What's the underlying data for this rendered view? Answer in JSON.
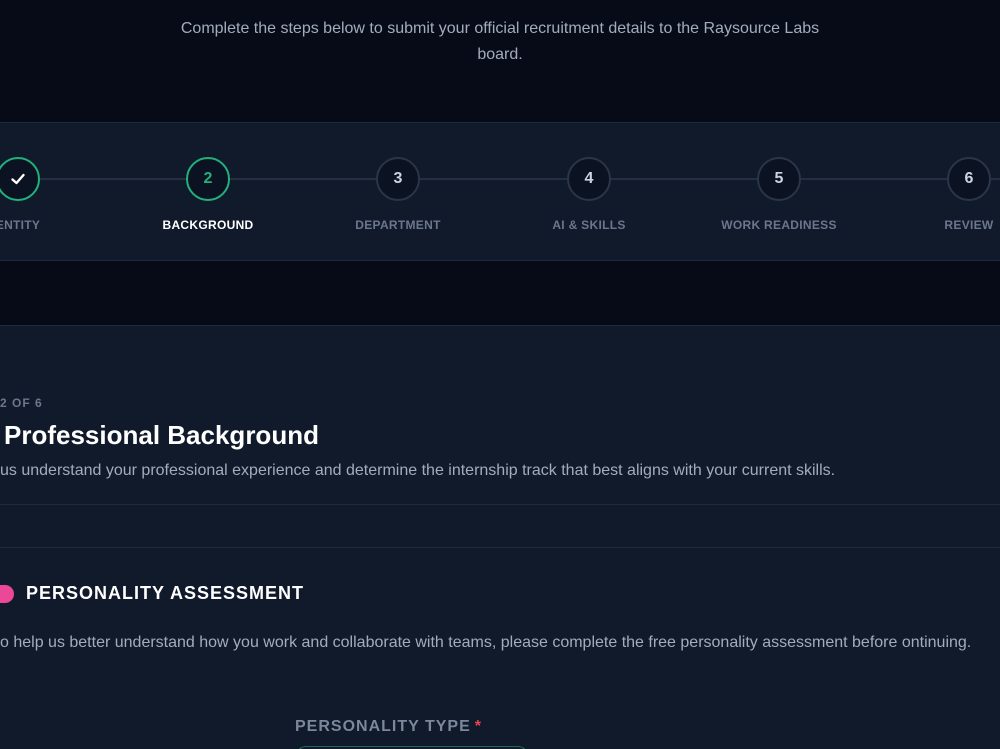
{
  "intro": {
    "line1": "Complete the steps below to submit your official recruitment details to the Raysource Labs",
    "line2": "board."
  },
  "stepper": {
    "steps": [
      {
        "number": "",
        "label": "ENTITY",
        "status": "done",
        "icon": "check-icon"
      },
      {
        "number": "2",
        "label": "BACKGROUND",
        "status": "active"
      },
      {
        "number": "3",
        "label": "DEPARTMENT",
        "status": "upcoming"
      },
      {
        "number": "4",
        "label": "AI & SKILLS",
        "status": "upcoming"
      },
      {
        "number": "5",
        "label": "WORK READINESS",
        "status": "upcoming"
      },
      {
        "number": "6",
        "label": "REVIEW",
        "status": "upcoming"
      }
    ]
  },
  "main": {
    "step_count": "2 OF 6",
    "title": "Professional Background",
    "description": "us understand your professional experience and determine the internship track that best aligns with your current skills."
  },
  "personality": {
    "icon": "brain-icon",
    "title": "PERSONALITY ASSESSMENT",
    "description": "o help us better understand how you work and collaborate with teams, please complete the free personality assessment before ontinuing.",
    "field_label": "PERSONALITY TYPE",
    "required_mark": "*"
  },
  "colors": {
    "accent": "#22b07d",
    "brain_icon": "#ec4899",
    "required": "#e5484d"
  }
}
